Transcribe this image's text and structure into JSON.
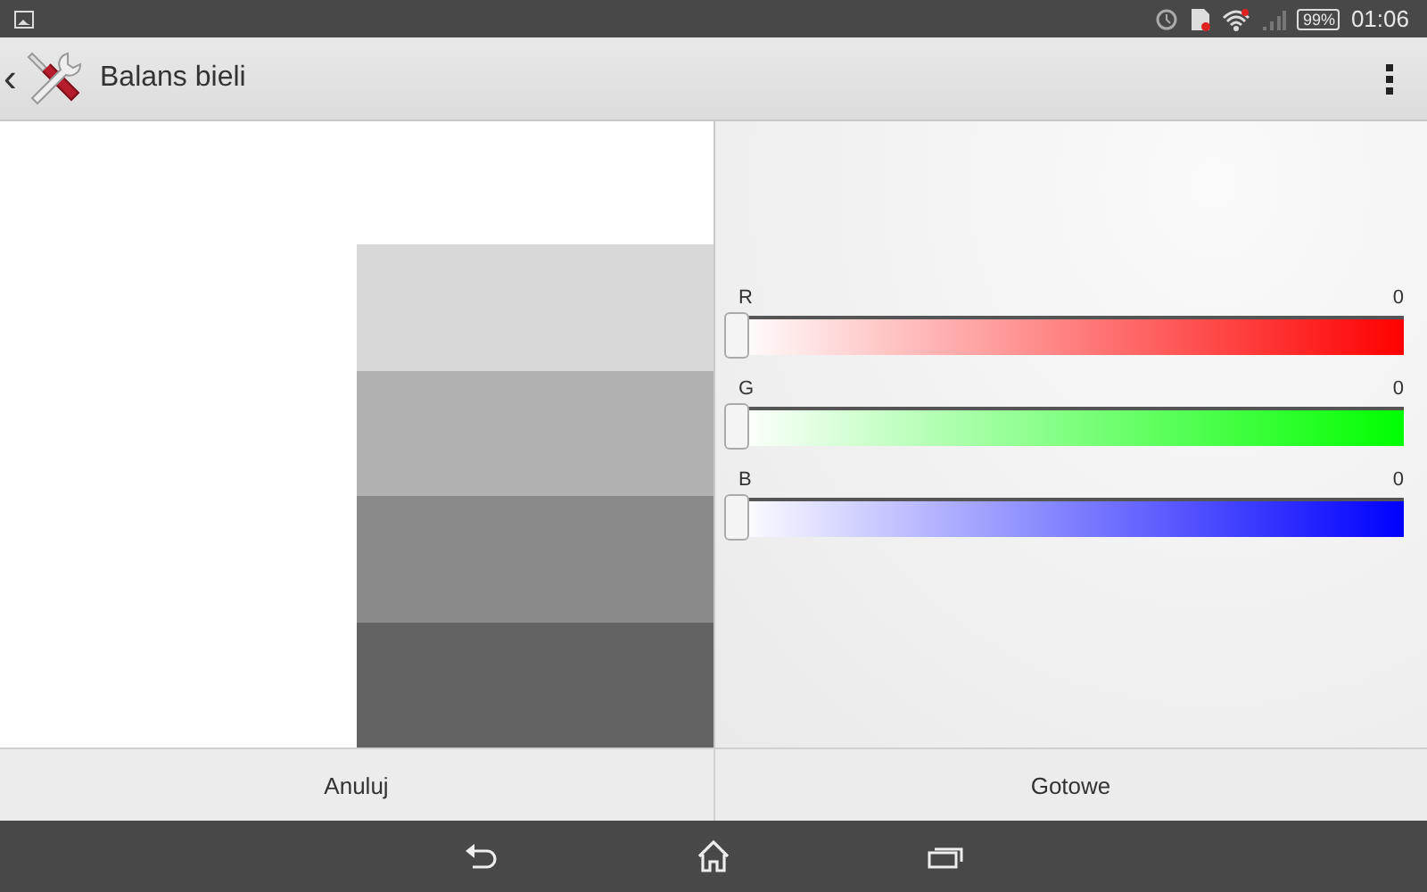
{
  "status_bar": {
    "battery": "99%",
    "time": "01:06"
  },
  "action_bar": {
    "back": "‹",
    "title": "Balans bieli"
  },
  "swatches": [
    {
      "color": "#d8d8d8"
    },
    {
      "color": "#b1b1b1"
    },
    {
      "color": "#8a8a8a"
    },
    {
      "color": "#636363"
    }
  ],
  "channels": [
    {
      "name": "R",
      "reading": "0",
      "level": 0,
      "color": "#ff0000"
    },
    {
      "name": "G",
      "reading": "0",
      "level": 0,
      "color": "#00ff00"
    },
    {
      "name": "B",
      "reading": "0",
      "level": 0,
      "color": "#0000ff"
    }
  ],
  "buttons": [
    "Anuluj",
    "Gotowe"
  ]
}
